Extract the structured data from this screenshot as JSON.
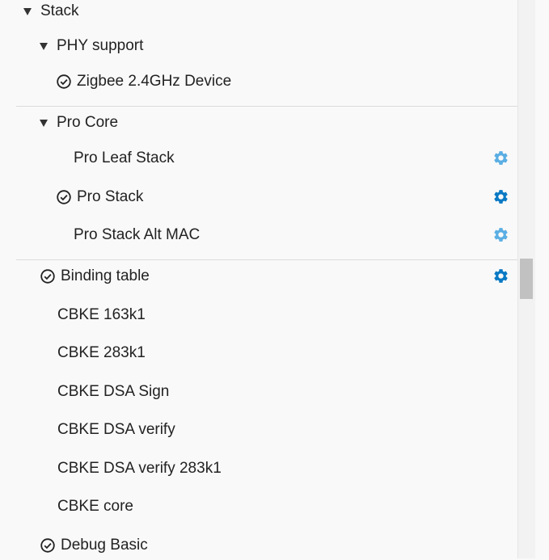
{
  "tree": {
    "stack_label": "Stack",
    "phy_support_label": "PHY support",
    "zigbee_device_label": "Zigbee 2.4GHz Device",
    "pro_core_label": "Pro Core",
    "pro_leaf_stack_label": "Pro Leaf Stack",
    "pro_stack_label": "Pro Stack",
    "pro_stack_alt_mac_label": "Pro Stack Alt MAC",
    "binding_table_label": "Binding table",
    "cbke_163k1_label": "CBKE 163k1",
    "cbke_283k1_label": "CBKE 283k1",
    "cbke_dsa_sign_label": "CBKE DSA Sign",
    "cbke_dsa_verify_label": "CBKE DSA verify",
    "cbke_dsa_verify_283k1_label": "CBKE DSA verify 283k1",
    "cbke_core_label": "CBKE core",
    "debug_basic_label": "Debug Basic"
  },
  "colors": {
    "gear_active": "#0a79c4",
    "gear_inactive": "#5aaee3",
    "separator": "#dcdcdc",
    "scroll_thumb": "#c1c1c1"
  },
  "icons": {
    "expand": "triangle-down-icon",
    "installed": "check-circle-icon",
    "configure": "gear-icon"
  }
}
